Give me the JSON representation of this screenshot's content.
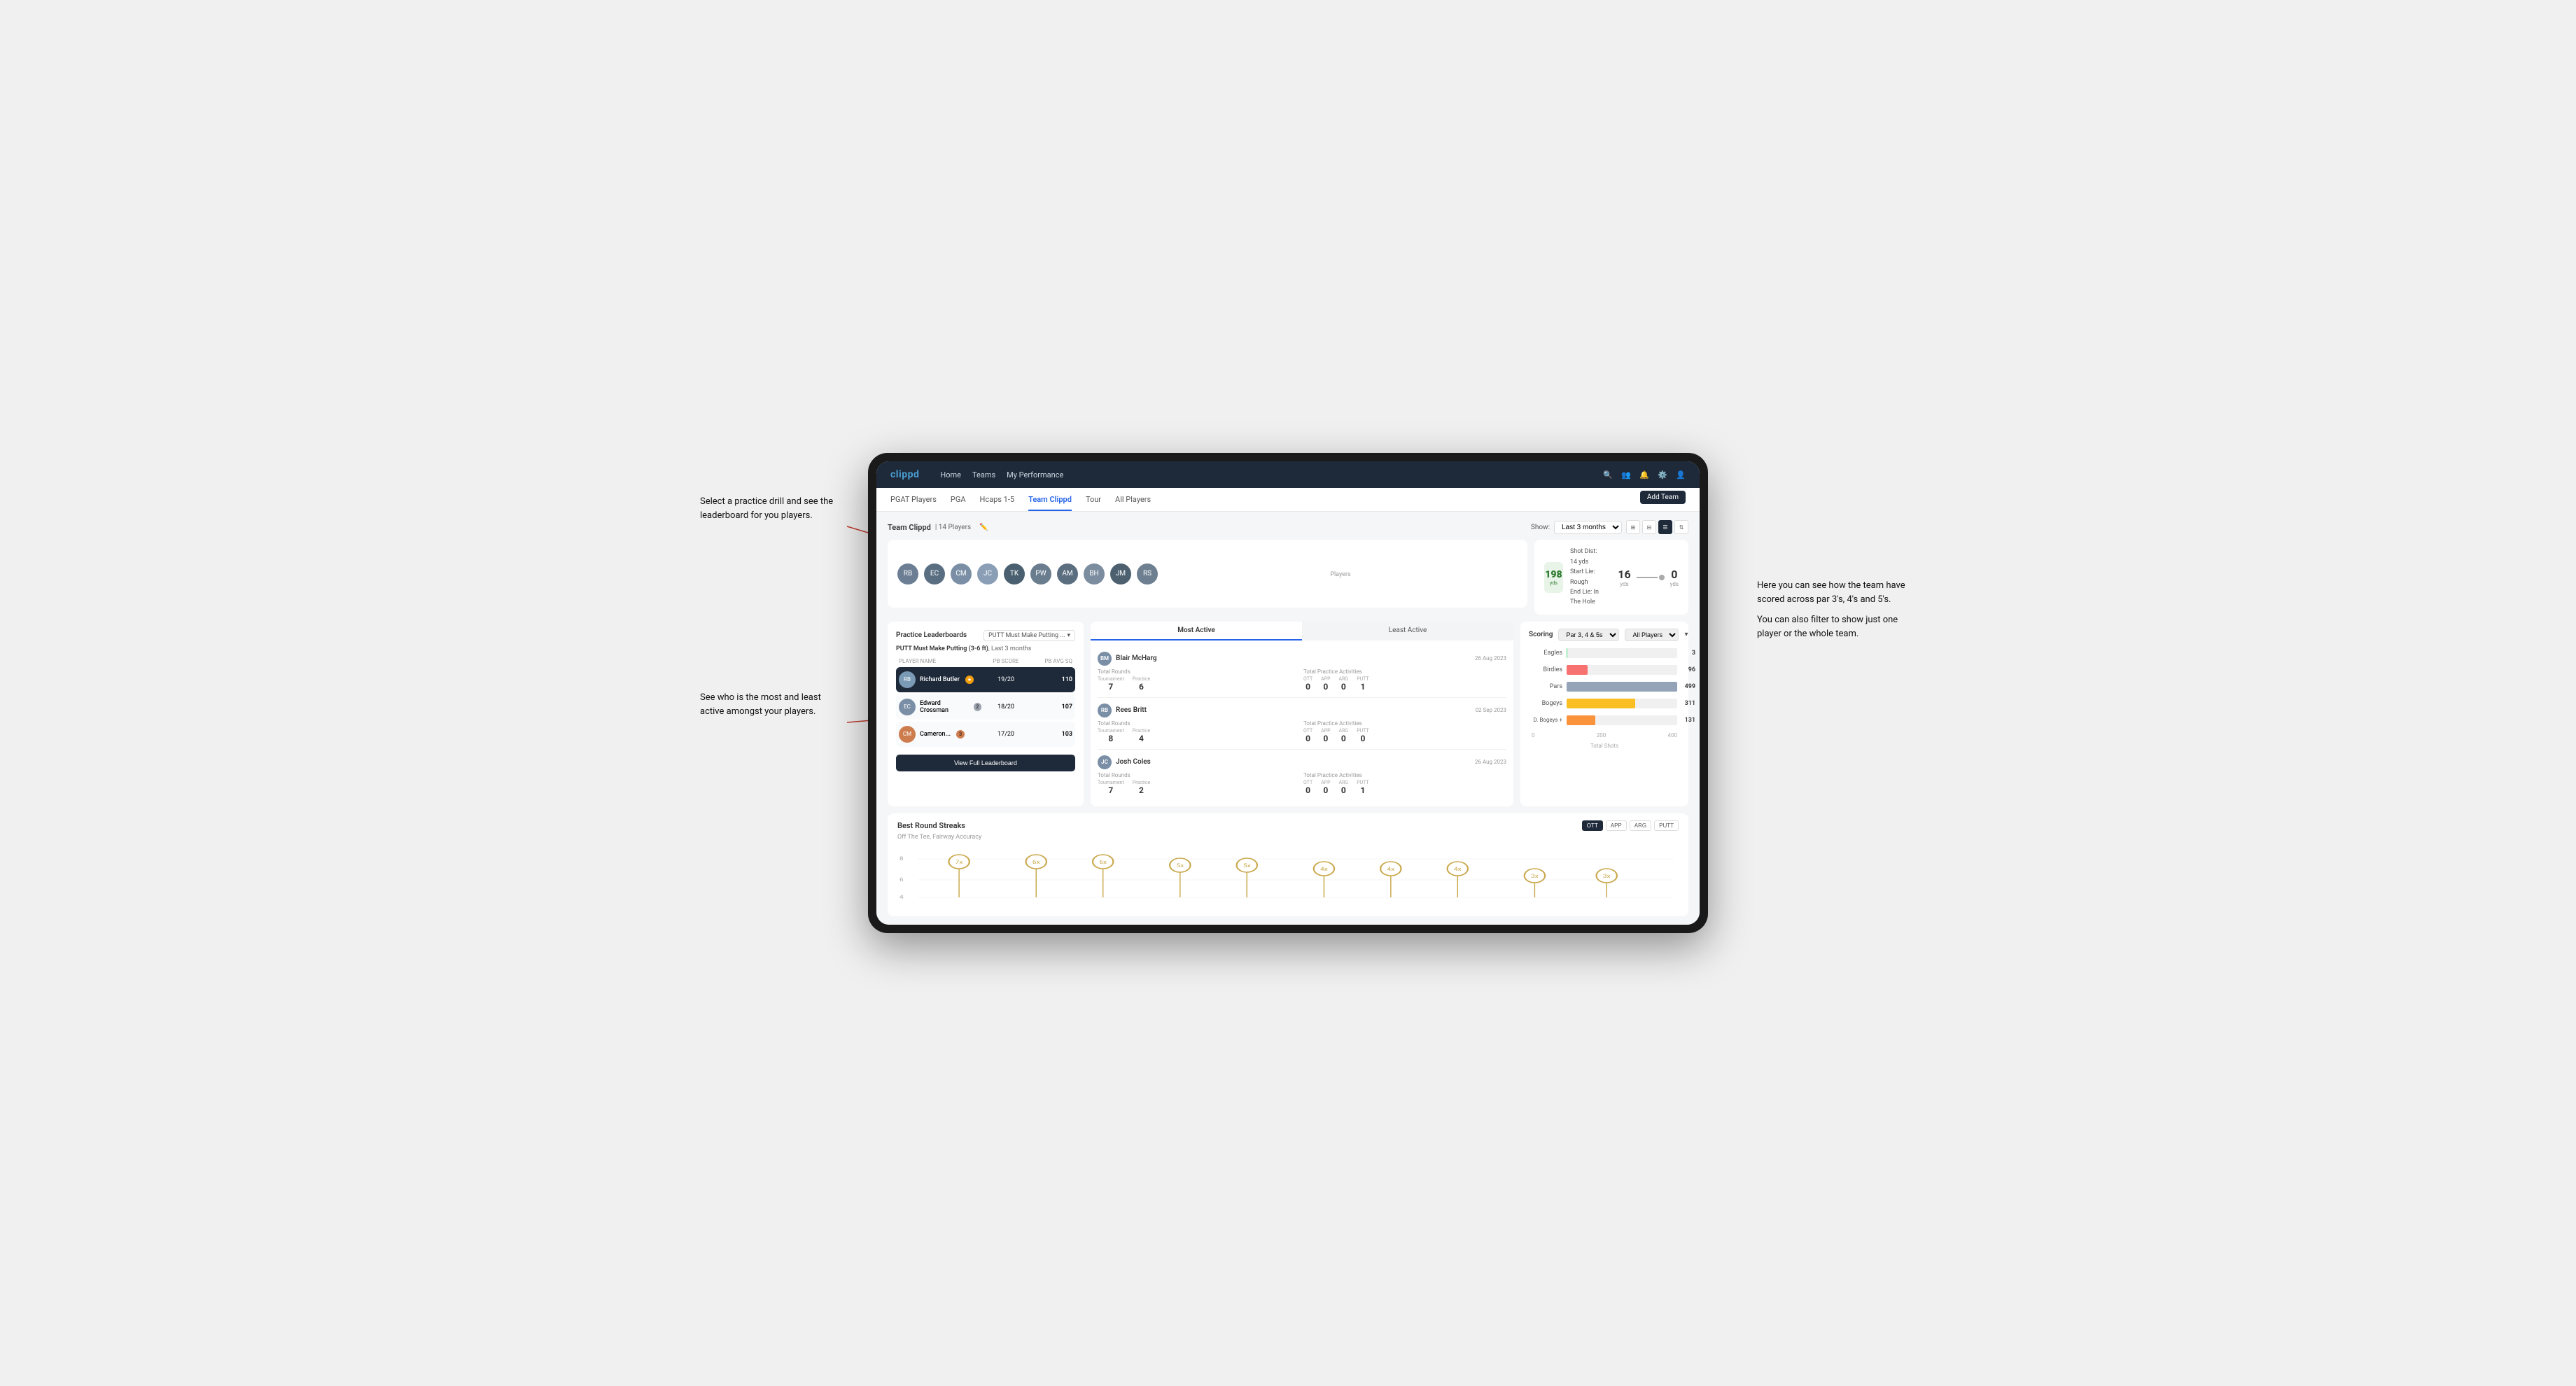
{
  "annotations": {
    "top_left": "Select a practice drill and see\nthe leaderboard for you players.",
    "bottom_left": "See who is the most and least\nactive amongst your players.",
    "top_right_title": "Here you can see how the\nteam have scored across\npar 3's, 4's and 5's.",
    "top_right_subtitle": "You can also filter to show\njust one player or the whole\nteam."
  },
  "nav": {
    "logo": "clippd",
    "links": [
      "Home",
      "Teams",
      "My Performance"
    ],
    "icons": [
      "🔍",
      "👤",
      "🔔",
      "⚙️",
      "👤"
    ]
  },
  "sub_nav": {
    "tabs": [
      "PGAT Players",
      "PGA",
      "Hcaps 1-5",
      "Team Clippd",
      "Tour",
      "All Players"
    ],
    "active_tab": "Team Clippd",
    "add_team_label": "Add Team"
  },
  "team_header": {
    "title": "Team Clippd",
    "player_count": "14 Players",
    "show_label": "Show:",
    "show_value": "Last 3 months",
    "view_modes": [
      "grid-sm",
      "grid-lg",
      "list",
      "filter"
    ]
  },
  "players_section": {
    "label": "Players",
    "avatars": [
      "RB",
      "EC",
      "CM",
      "JC",
      "TK",
      "PW",
      "AM",
      "BH",
      "JM",
      "RS"
    ]
  },
  "shot_info": {
    "distance": "198",
    "distance_unit": "yds",
    "shot_dist_label": "Shot Dist: 14 yds",
    "start_lie_label": "Start Lie: Rough",
    "end_lie_label": "End Lie: In The Hole",
    "yds_left": "16",
    "yds_right": "0",
    "yds_unit": "yds"
  },
  "practice_lb": {
    "title": "Practice Leaderboards",
    "dropdown_label": "PUTT Must Make Putting ...",
    "subtitle_drill": "PUTT Must Make Putting (3-6 ft)",
    "subtitle_period": "Last 3 months",
    "col_player": "PLAYER NAME",
    "col_score": "PB SCORE",
    "col_avg": "PB AVG SQ",
    "players": [
      {
        "name": "Richard Butler",
        "score": "19/20",
        "avg": "110",
        "medal": "gold",
        "rank": 1
      },
      {
        "name": "Edward Crossman",
        "score": "18/20",
        "avg": "107",
        "medal": "silver",
        "rank": 2
      },
      {
        "name": "Cameron...",
        "score": "17/20",
        "avg": "103",
        "medal": "bronze",
        "rank": 3
      }
    ],
    "view_full_label": "View Full Leaderboard"
  },
  "activity": {
    "tabs": [
      "Most Active",
      "Least Active"
    ],
    "active_tab": "Most Active",
    "players": [
      {
        "name": "Blair McHarg",
        "date": "26 Aug 2023",
        "total_rounds_label": "Total Rounds",
        "tournament_val": "7",
        "practice_val": "6",
        "total_practice_label": "Total Practice Activities",
        "ott_val": "0",
        "app_val": "0",
        "arg_val": "0",
        "putt_val": "1",
        "tournament_label": "Tournament",
        "practice_label": "Practice"
      },
      {
        "name": "Rees Britt",
        "date": "02 Sep 2023",
        "total_rounds_label": "Total Rounds",
        "tournament_val": "8",
        "practice_val": "4",
        "total_practice_label": "Total Practice Activities",
        "ott_val": "0",
        "app_val": "0",
        "arg_val": "0",
        "putt_val": "0",
        "tournament_label": "Tournament",
        "practice_label": "Practice"
      },
      {
        "name": "Josh Coles",
        "date": "26 Aug 2023",
        "total_rounds_label": "Total Rounds",
        "tournament_val": "7",
        "practice_val": "2",
        "total_practice_label": "Total Practice Activities",
        "ott_val": "0",
        "app_val": "0",
        "arg_val": "0",
        "putt_val": "1",
        "tournament_label": "Tournament",
        "practice_label": "Practice"
      }
    ]
  },
  "scoring": {
    "title": "Scoring",
    "par_filter": "Par 3, 4 & 5s",
    "player_filter": "All Players",
    "bars": [
      {
        "label": "Eagles",
        "value": 3,
        "max": 500,
        "color": "#4ade80"
      },
      {
        "label": "Birdies",
        "value": 96,
        "max": 500,
        "color": "#f87171"
      },
      {
        "label": "Pars",
        "value": 499,
        "max": 500,
        "color": "#94a3b8"
      },
      {
        "label": "Bogeys",
        "value": 311,
        "max": 500,
        "color": "#fbbf24"
      },
      {
        "label": "D. Bogeys +",
        "value": 131,
        "max": 500,
        "color": "#fb923c"
      }
    ],
    "axis": [
      "0",
      "200",
      "400"
    ],
    "footer": "Total Shots"
  },
  "streaks": {
    "title": "Best Round Streaks",
    "subtitle": "Off The Tee, Fairway Accuracy",
    "filters": [
      "OTT",
      "APP",
      "ARG",
      "PUTT"
    ],
    "active_filter": "OTT",
    "dots": [
      {
        "label": "7x",
        "x": 8
      },
      {
        "label": "6x",
        "x": 18
      },
      {
        "label": "6x",
        "x": 27
      },
      {
        "label": "5x",
        "x": 37
      },
      {
        "label": "5x",
        "x": 46
      },
      {
        "label": "4x",
        "x": 56
      },
      {
        "label": "4x",
        "x": 65
      },
      {
        "label": "4x",
        "x": 74
      },
      {
        "label": "3x",
        "x": 84
      },
      {
        "label": "3x",
        "x": 93
      }
    ]
  }
}
